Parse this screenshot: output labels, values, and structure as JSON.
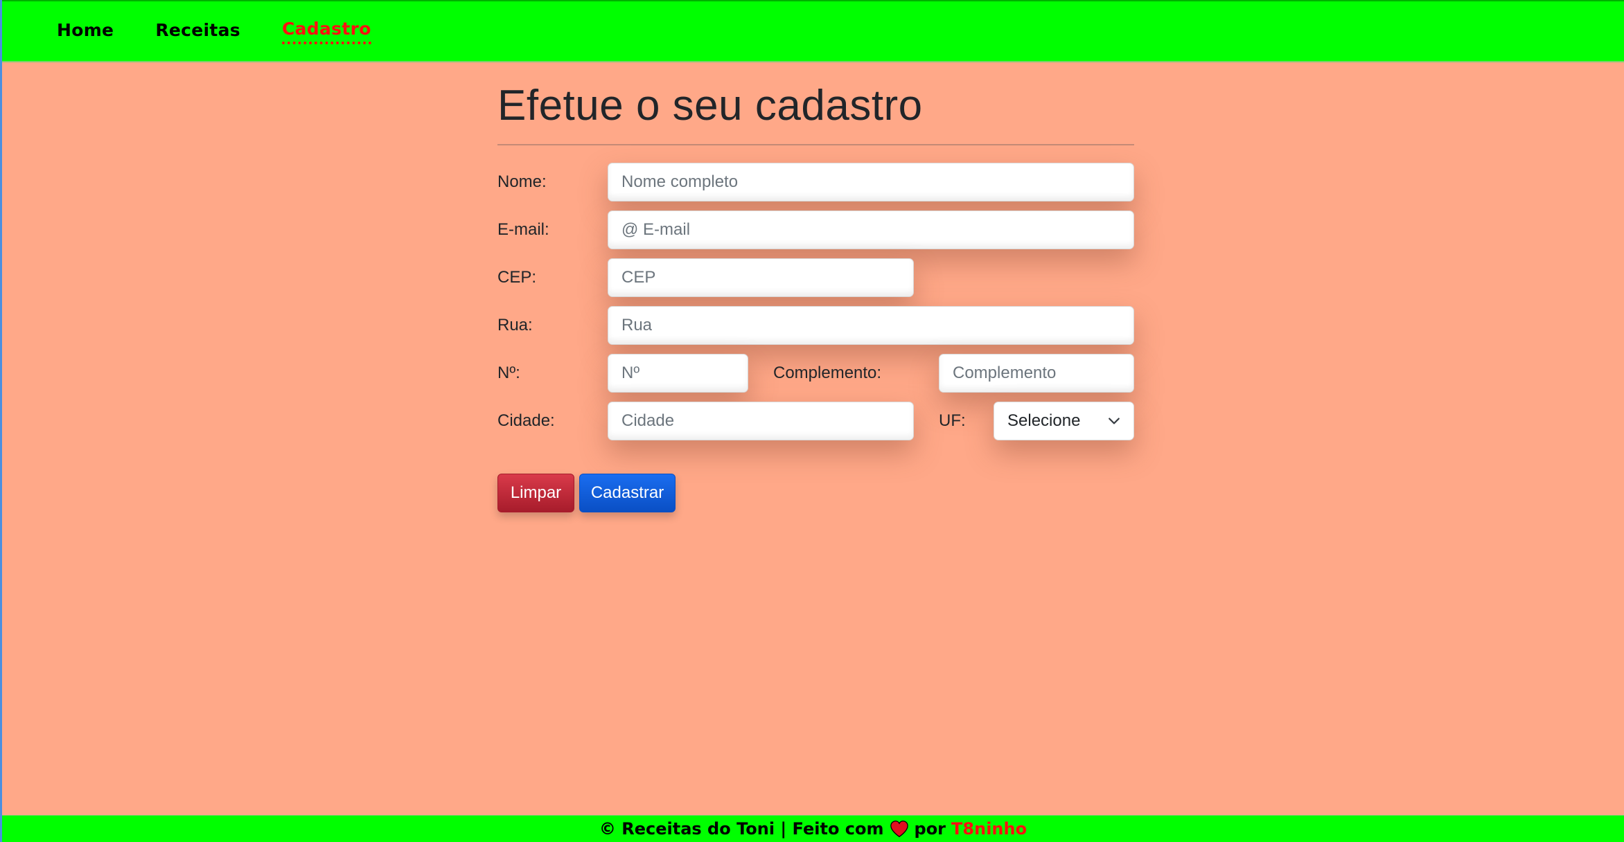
{
  "nav": {
    "items": [
      {
        "label": "Home"
      },
      {
        "label": "Receitas"
      },
      {
        "label": "Cadastro",
        "active": true
      }
    ]
  },
  "page": {
    "title": "Efetue o seu cadastro"
  },
  "form": {
    "nome": {
      "label": "Nome:",
      "placeholder": "Nome completo"
    },
    "email": {
      "label": "E-mail:",
      "placeholder": "@ E-mail"
    },
    "cep": {
      "label": "CEP:",
      "placeholder": "CEP"
    },
    "rua": {
      "label": "Rua:",
      "placeholder": "Rua"
    },
    "numero": {
      "label": "Nº:",
      "placeholder": "Nº"
    },
    "complemento": {
      "label": "Complemento:",
      "placeholder": "Complemento"
    },
    "cidade": {
      "label": "Cidade:",
      "placeholder": "Cidade"
    },
    "uf": {
      "label": "UF:",
      "selected": "Selecione"
    },
    "buttons": {
      "clear": "Limpar",
      "submit": "Cadastrar"
    }
  },
  "footer": {
    "copyright": "© Receitas do Toni | Feito com",
    "by": "por",
    "author": "T8ninho"
  },
  "colors": {
    "background": "#ffa888",
    "navbar": "#00ff00",
    "active_link": "#ff1010",
    "danger": "#c82333",
    "primary": "#0d5bd7"
  },
  "icons": {
    "uf_select": "chevron-down-icon",
    "footer_heart": "heart-icon"
  }
}
